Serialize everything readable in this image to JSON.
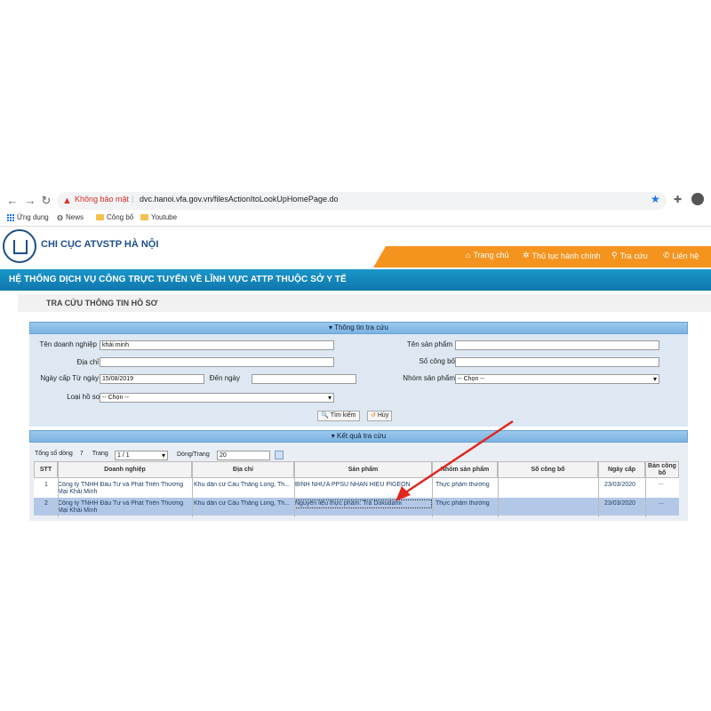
{
  "browser": {
    "not_secure": "Không bảo mật",
    "url": "dvc.hanoi.vfa.gov.vn/filesActionItoLookUpHomePage.do",
    "bookmarks": [
      "Ứng dụng",
      "News",
      "Công bố",
      "Youtube"
    ]
  },
  "site": {
    "title": "CHI CỤC ATVSTP HÀ NỘI",
    "banner": "HỆ THỐNG DỊCH VỤ CÔNG TRỰC TUYẾN VỀ LĨNH VỰC ATTP THUỘC SỞ Y TẾ",
    "menu": [
      "Trang chủ",
      "Thủ tục hành chính",
      "Tra cứu",
      "Liên hệ"
    ]
  },
  "page_title": "TRA CỨU THÔNG TIN HỒ SƠ",
  "search": {
    "header": "Thông tin tra cứu",
    "company_label": "Tên doanh nghiệp",
    "company_value": "khải minh",
    "address_label": "Địa chỉ",
    "date_from_label": "Ngày cấp Từ ngày",
    "date_from_value": "15/08/2019",
    "date_to_label": "Đến ngày",
    "type_label": "Loại hồ sơ",
    "type_value": "-- Chọn --",
    "product_label": "Tên sản phẩm",
    "announce_label": "Số công bố",
    "group_label": "Nhóm sản phẩm",
    "group_value": "-- Chọn --",
    "search_button": "Tìm kiếm",
    "cancel_button": "Hủy"
  },
  "results": {
    "header": "Kết quả tra cứu",
    "total_label": "Tổng số dòng",
    "total_value": "7",
    "page_label": "Trang",
    "page_value": "1 / 1",
    "rows_label": "Dòng/Trang",
    "rows_value": "20",
    "columns": [
      "STT",
      "Doanh nghiệp",
      "Địa chỉ",
      "Sản phẩm",
      "Nhóm sản phẩm",
      "Số công bố",
      "Ngày cấp",
      "Bản công bố"
    ],
    "rows": [
      {
        "stt": "1",
        "company": "Công ty TNHH Đầu Tư và Phát Triển Thương Mại Khải Minh",
        "address": "Khu dân cư Cầu Thăng Long, Th...",
        "product": "BÌNH NHỰA PPSU NHÃN HIỆU PIGEON",
        "group": "Thực phẩm thường",
        "number": "",
        "date": "23/03/2020",
        "doc": "..."
      },
      {
        "stt": "2",
        "company": "Công ty TNHH Đầu Tư và Phát Triển Thương Mại Khải Minh",
        "address": "Khu dân cư Cầu Thăng Long, Th...",
        "product": "Nguyên liệu thực phẩm: Trà Dokudami",
        "group": "Thực phẩm thường",
        "number": "",
        "date": "23/03/2020",
        "doc": "..."
      }
    ]
  },
  "colors": {
    "menu": "#f4941e",
    "banner": "#1a96c9",
    "arrow": "#e0271e"
  }
}
